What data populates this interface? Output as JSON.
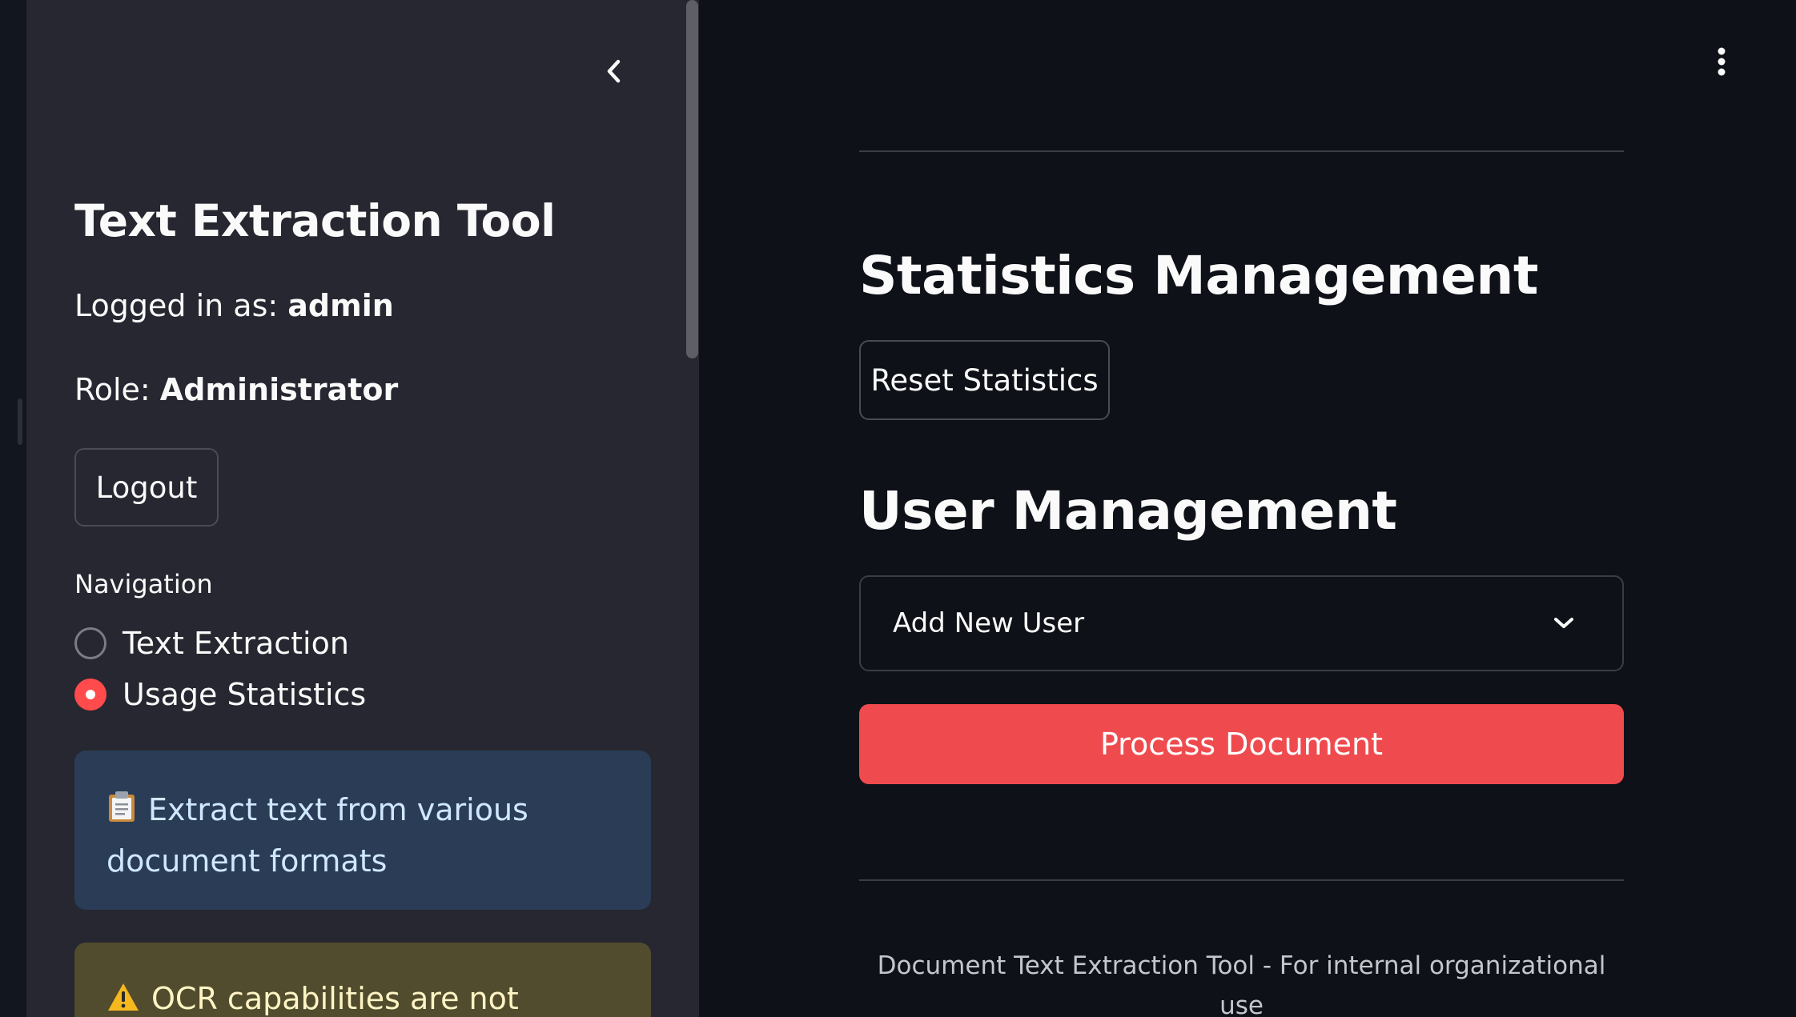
{
  "sidebar": {
    "title": "Text Extraction Tool",
    "logged_in_prefix": "Logged in as:",
    "username": "admin",
    "role_prefix": "Role:",
    "role": "Administrator",
    "logout_label": "Logout",
    "navigation": {
      "label": "Navigation",
      "options": [
        {
          "label": "Text Extraction",
          "selected": false
        },
        {
          "label": "Usage Statistics",
          "selected": true
        }
      ]
    },
    "info_message": "Extract text from various document formats",
    "warning_message": "OCR capabilities are not available."
  },
  "main": {
    "statistics_heading": "Statistics Management",
    "reset_statistics_label": "Reset Statistics",
    "user_management_heading": "User Management",
    "add_user_expander_label": "Add New User",
    "process_button_label": "Process Document",
    "footer_text": "Document Text Extraction Tool - For internal organizational use"
  },
  "colors": {
    "background": "#0e1117",
    "sidebar_background": "#262730",
    "primary_accent": "#ff4b4b",
    "info_background": "#2a3c56",
    "warning_background": "#524c2e"
  },
  "icons": {
    "collapse": "chevron-left-icon",
    "menu": "vertical-dots-icon",
    "info": "clipboard-icon",
    "warning": "warning-icon",
    "expander": "chevron-down-icon"
  }
}
